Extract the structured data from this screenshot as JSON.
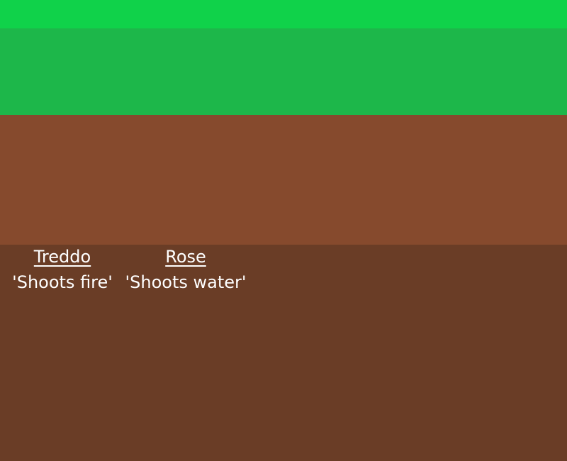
{
  "scene": {
    "colors": {
      "grass_top": "#10d24a",
      "grass": "#1db74a",
      "dirt": "#864a2d",
      "deep_soil": "#6a3d26",
      "text": "#ffffff"
    }
  },
  "characters": [
    {
      "name": "Treddo",
      "description": "'Shoots fire'"
    },
    {
      "name": "Rose",
      "description": "'Shoots water'"
    }
  ]
}
